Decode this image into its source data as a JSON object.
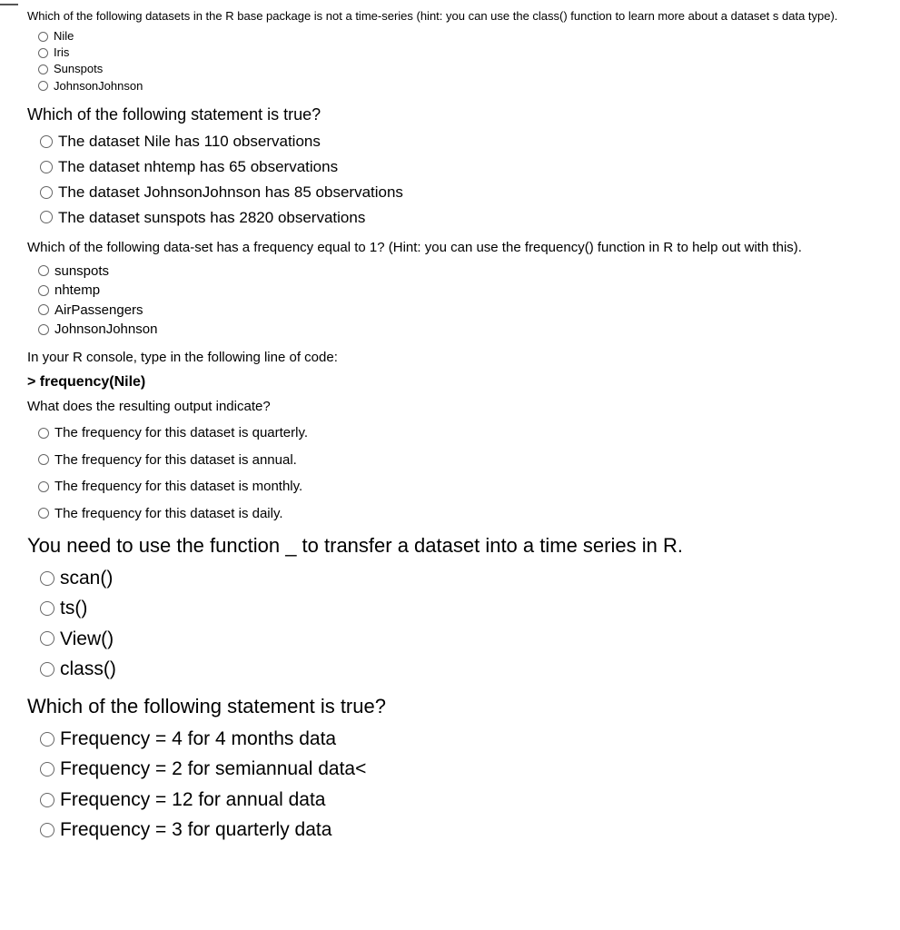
{
  "questions": [
    {
      "prompt": "Which of the following datasets in the R base package is not a time-series (hint: you can use the class() function to learn more about a dataset s data type).",
      "options": [
        "Nile",
        "Iris",
        "Sunspots",
        "JohnsonJohnson"
      ]
    },
    {
      "prompt": "Which of the following statement is true?",
      "options": [
        "The dataset Nile has 110 observations",
        "The dataset nhtemp has 65 observations",
        "The dataset JohnsonJohnson has 85 observations",
        "The dataset sunspots has 2820 observations"
      ]
    },
    {
      "prompt": "Which of the following data-set has a frequency equal to 1? (Hint: you can use the frequency() function in R to help out with this).",
      "options": [
        "sunspots",
        "nhtemp",
        "AirPassengers",
        "JohnsonJohnson"
      ]
    },
    {
      "prompt": "In your R console, type in the following line of code:",
      "code": "> frequency(Nile)",
      "prompt2": "What does the resulting output indicate?",
      "options": [
        "The frequency for this dataset is quarterly.",
        "The frequency for this dataset is annual.",
        "The frequency for this dataset is monthly.",
        "The frequency for this dataset is daily."
      ]
    },
    {
      "prompt": "You need to use the function _ to transfer a dataset into a time series in R.",
      "options": [
        "scan()",
        "ts()",
        "View()",
        "class()"
      ]
    },
    {
      "prompt": "Which of the following statement is true?",
      "options": [
        "Frequency = 4 for 4 months data",
        "Frequency = 2 for semiannual data<",
        "Frequency = 12 for annual data",
        "Frequency = 3 for quarterly data"
      ]
    }
  ]
}
